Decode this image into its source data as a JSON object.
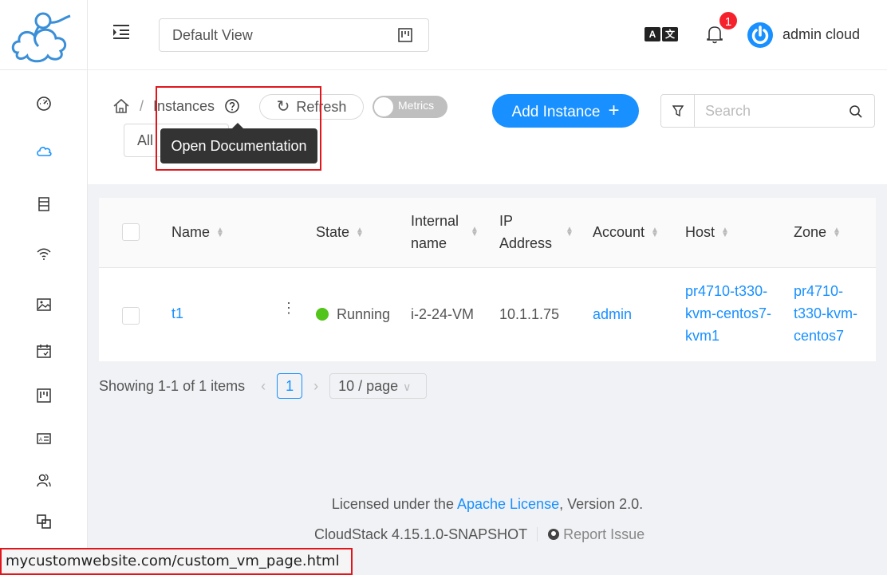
{
  "header": {
    "view_select": "Default View",
    "notification_count": "1",
    "user_name": "admin cloud"
  },
  "breadcrumb": {
    "page": "Instances"
  },
  "toolbar": {
    "refresh_label": "Refresh",
    "metrics_label": "Metrics",
    "add_label": "Add Instance",
    "search_placeholder": "Search",
    "filter_value": "All"
  },
  "tooltip": "Open Documentation",
  "table": {
    "columns": [
      "Name",
      "State",
      "Internal",
      "name",
      "IP",
      "Address",
      "Account",
      "Host",
      "Zone"
    ],
    "row": {
      "name": "t1",
      "state": "Running",
      "internal_name": "i-2-24-VM",
      "ip": "10.1.1.75",
      "account": "admin",
      "host": [
        "pr4710-t330-",
        "kvm-centos7-",
        "kvm1"
      ],
      "zone": [
        "pr4710-",
        "t330-kvm-",
        "centos7"
      ]
    }
  },
  "pager": {
    "summary": "Showing 1-1 of 1 items",
    "page": "1",
    "page_size": "10 / page"
  },
  "footer": {
    "licensed": "Licensed under the",
    "license_link": "Apache License",
    "version_suffix": ", Version 2.0.",
    "product": "CloudStack 4.15.1.0-SNAPSHOT",
    "report": "Report Issue"
  },
  "statusbar": "mycustomwebsite.com/custom_vm_page.html",
  "colors": {
    "primary": "#1890ff",
    "success": "#52c41a",
    "danger": "#f5222d",
    "highlight": "#e0161c"
  }
}
